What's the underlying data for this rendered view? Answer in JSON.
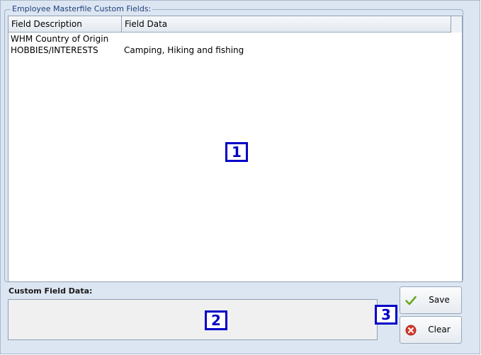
{
  "groupbox": {
    "title": "Employee Masterfile Custom Fields:"
  },
  "grid": {
    "columns": [
      "Field Description",
      "Field Data"
    ],
    "rows": [
      {
        "description": "WHM Country of Origin",
        "data": ""
      },
      {
        "description": "HOBBIES/INTERESTS",
        "data": "Camping, Hiking and fishing"
      }
    ]
  },
  "custom_field": {
    "label": "Custom Field Data:",
    "value": ""
  },
  "buttons": {
    "save_label": "Save",
    "clear_label": "Clear"
  },
  "annotations": {
    "badge_1": "1",
    "badge_2": "2",
    "badge_3": "3"
  },
  "icons": {
    "save": "checkmark-icon",
    "clear": "clear-x-icon"
  },
  "colors": {
    "panel_background": "#dce6f2",
    "annotation_blue": "#0000c8",
    "save_check_green": "#6aa820",
    "clear_red": "#d83a2e"
  }
}
